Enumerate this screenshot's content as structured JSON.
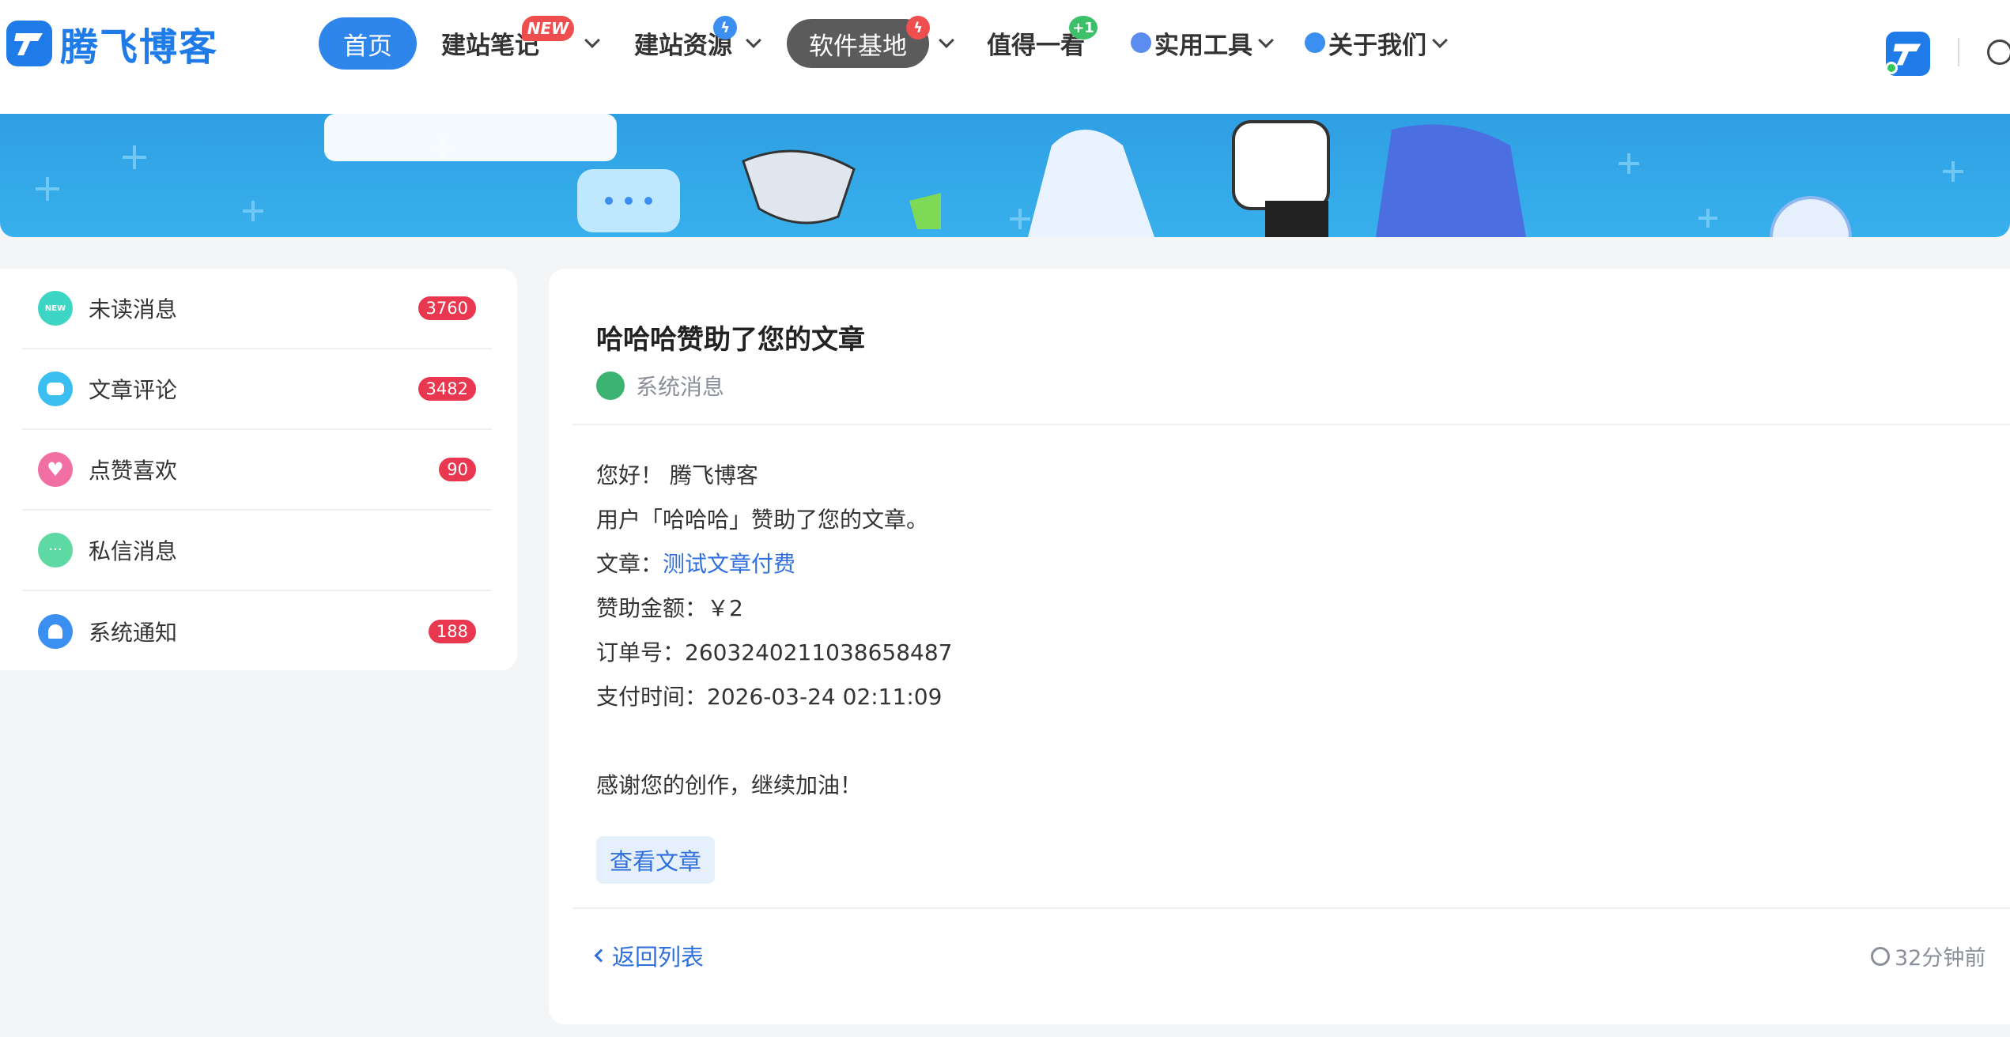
{
  "header": {
    "logo_text": "腾飞博客",
    "nav": [
      {
        "label": "首页"
      },
      {
        "label": "建站笔记",
        "badge": "NEW"
      },
      {
        "label": "建站资源"
      },
      {
        "label": "软件基地"
      },
      {
        "label": "值得一看",
        "badge": "+1"
      },
      {
        "label": "实用工具"
      },
      {
        "label": "关于我们"
      }
    ]
  },
  "sidebar": {
    "items": [
      {
        "label": "未读消息",
        "count": "3760",
        "icon": "new-icon",
        "color": "#3dd6c4"
      },
      {
        "label": "文章评论",
        "count": "3482",
        "icon": "comment-icon",
        "color": "#3bbff0"
      },
      {
        "label": "点赞喜欢",
        "count": "90",
        "icon": "heart-icon",
        "color": "#f26fa4"
      },
      {
        "label": "私信消息",
        "count": "",
        "icon": "chat-icon",
        "color": "#5fd9a4"
      },
      {
        "label": "系统通知",
        "count": "188",
        "icon": "bell-icon",
        "color": "#3b8ff0"
      }
    ]
  },
  "message": {
    "title": "哈哈哈赞助了您的文章",
    "source": "系统消息",
    "greeting": "您好！ 腾飞博客",
    "line_user": "用户「哈哈哈」赞助了您的文章。",
    "article_prefix": "文章：",
    "article_link": "测试文章付费",
    "amount": "赞助金额：￥2",
    "order": "订单号：2603240211038658487",
    "pay_time": "支付时间：2026-03-24 02:11:09",
    "thanks": "感谢您的创作，继续加油！",
    "view_button": "查看文章",
    "back_link": "返回列表",
    "time_ago": "32分钟前"
  },
  "colors": {
    "accent": "#2f86ea",
    "link": "#2f6fde",
    "badge": "#e8374f"
  }
}
